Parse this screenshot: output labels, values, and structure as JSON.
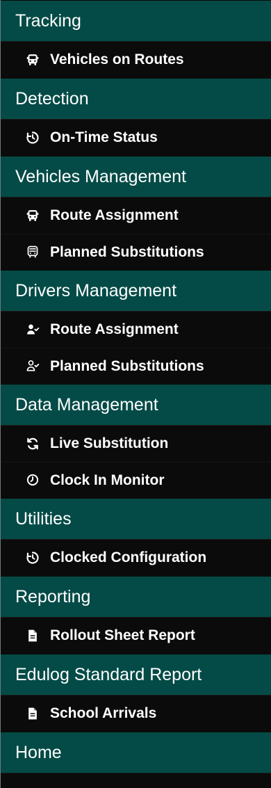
{
  "sidebar": {
    "sections": [
      {
        "title": "Tracking",
        "items": [
          {
            "label": "Vehicles on Routes",
            "icon": "bus-icon"
          }
        ]
      },
      {
        "title": "Detection",
        "items": [
          {
            "label": "On-Time Status",
            "icon": "timer-icon"
          }
        ]
      },
      {
        "title": "Vehicles Management",
        "items": [
          {
            "label": "Route Assignment",
            "icon": "bus-icon"
          },
          {
            "label": "Planned Substitutions",
            "icon": "bus-outline-icon"
          }
        ]
      },
      {
        "title": "Drivers Management",
        "items": [
          {
            "label": "Route Assignment",
            "icon": "user-check-icon"
          },
          {
            "label": "Planned Substitutions",
            "icon": "user-check-outline-icon"
          }
        ]
      },
      {
        "title": "Data Management",
        "items": [
          {
            "label": "Live Substitution",
            "icon": "refresh-icon"
          },
          {
            "label": "Clock In Monitor",
            "icon": "clock-icon"
          }
        ]
      },
      {
        "title": "Utilities",
        "items": [
          {
            "label": "Clocked Configuration",
            "icon": "timer-icon"
          }
        ]
      },
      {
        "title": "Reporting",
        "items": [
          {
            "label": "Rollout Sheet Report",
            "icon": "document-icon"
          }
        ]
      },
      {
        "title": "Edulog Standard Report",
        "items": [
          {
            "label": "School Arrivals",
            "icon": "document-icon"
          }
        ]
      },
      {
        "title": "Home",
        "items": []
      }
    ]
  },
  "colors": {
    "section_background": "#044b47",
    "item_background": "#0b0b0b",
    "text": "#ffffff"
  }
}
